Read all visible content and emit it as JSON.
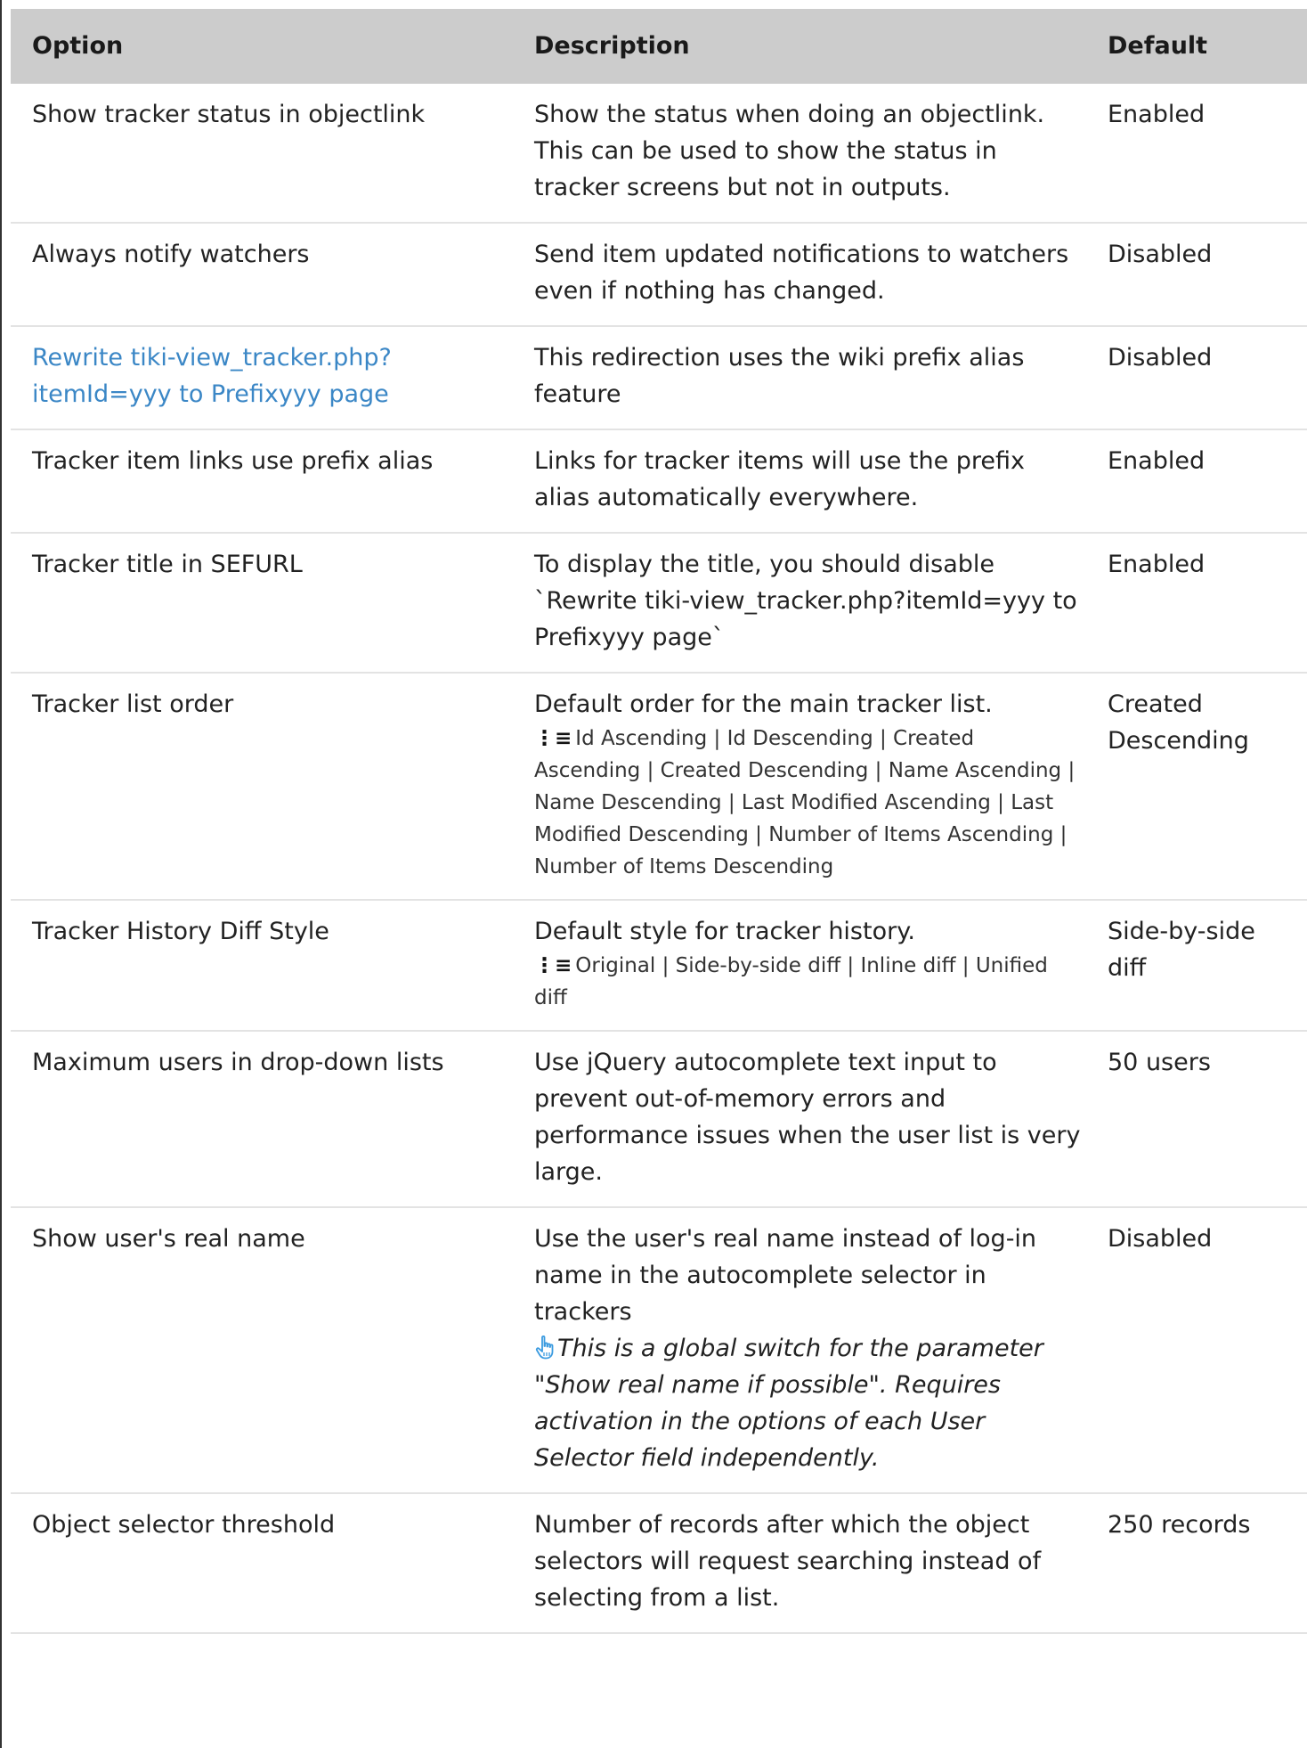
{
  "table": {
    "headers": {
      "option": "Option",
      "description": "Description",
      "default": "Default"
    },
    "rows": [
      {
        "option": "Show tracker status in objectlink",
        "description": "Show the status when doing an objectlink. This can be used to show the status in tracker screens but not in outputs.",
        "default": "Enabled"
      },
      {
        "option": "Always notify watchers",
        "description": "Send item updated notifications to watchers even if nothing has changed.",
        "default": "Disabled"
      },
      {
        "option": "Rewrite tiki-view_tracker.php?itemId=yyy to Prefixyyy page",
        "description": "This redirection uses the wiki prefix alias feature",
        "default": "Disabled"
      },
      {
        "option": "Tracker item links use prefix alias",
        "description": "Links for tracker items will use the prefix alias automatically everywhere.",
        "default": "Enabled"
      },
      {
        "option": "Tracker title in SEFURL",
        "description": "To display the title, you should disable `Rewrite tiki-view_tracker.php?itemId=yyy to Prefixyyy page`",
        "default": "Enabled"
      },
      {
        "option": "Tracker list order",
        "description": "Default order for the main tracker list.",
        "options": "Id Ascending | Id Descending | Created Ascending | Created Descending | Name Ascending | Name Descending | Last Modified Ascending | Last Modified Descending | Number of Items Ascending | Number of Items Descending",
        "default": "Created Descending"
      },
      {
        "option": "Tracker History Diff Style",
        "description": "Default style for tracker history.",
        "options": "Original | Side-by-side diff | Inline diff | Unified diff",
        "default": "Side-by-side diff"
      },
      {
        "option": "Maximum users in drop-down lists",
        "description": "Use jQuery autocomplete text input to prevent out-of-memory errors and performance issues when the user list is very large.",
        "default": "50 users"
      },
      {
        "option": "Show user's real name",
        "description": "Use the user's real name instead of log-in name in the autocomplete selector in trackers",
        "hint": "This is a global switch for the parameter \"Show real name if possible\". Requires activation in the options of each User Selector field independently.",
        "default": "Disabled"
      },
      {
        "option": "Object selector threshold",
        "description": "Number of records after which the object selectors will request searching instead of selecting from a list.",
        "default": "250 records"
      }
    ]
  },
  "icons": {
    "list_icon": "list-icon",
    "hint_icon": "pointing-hand-icon"
  },
  "colors": {
    "header_bg": "#cccccc",
    "link": "#3b87c6",
    "hint_icon": "#3b9be0"
  }
}
